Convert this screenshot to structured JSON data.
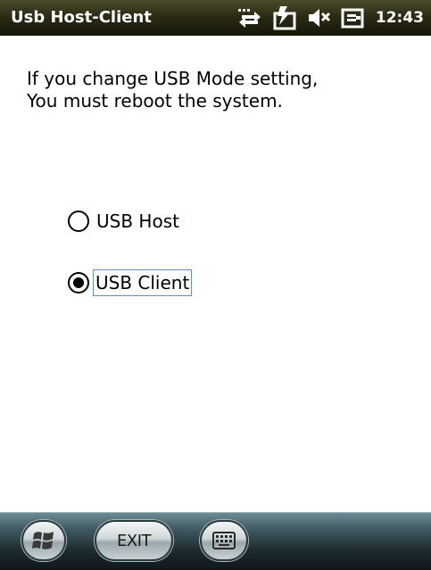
{
  "titlebar": {
    "title": "Usb Host-Client",
    "clock": "12:43",
    "icons": [
      "connectivity-icon",
      "battery-charging-icon",
      "volume-mute-icon",
      "power-plug-icon"
    ]
  },
  "message": {
    "line1": "If you change USB Mode setting,",
    "line2": "You must reboot the system."
  },
  "options": {
    "host_label": "USB Host",
    "client_label": "USB Client",
    "selected": "USB Client"
  },
  "bottombar": {
    "start_icon": "windows-start-icon",
    "exit_label": "EXIT",
    "keyboard_icon": "keyboard-icon"
  },
  "colors": {
    "titlebar": "#2c2c14",
    "bottombar": "#1e2b30",
    "focus_border": "#6a8cc0"
  }
}
